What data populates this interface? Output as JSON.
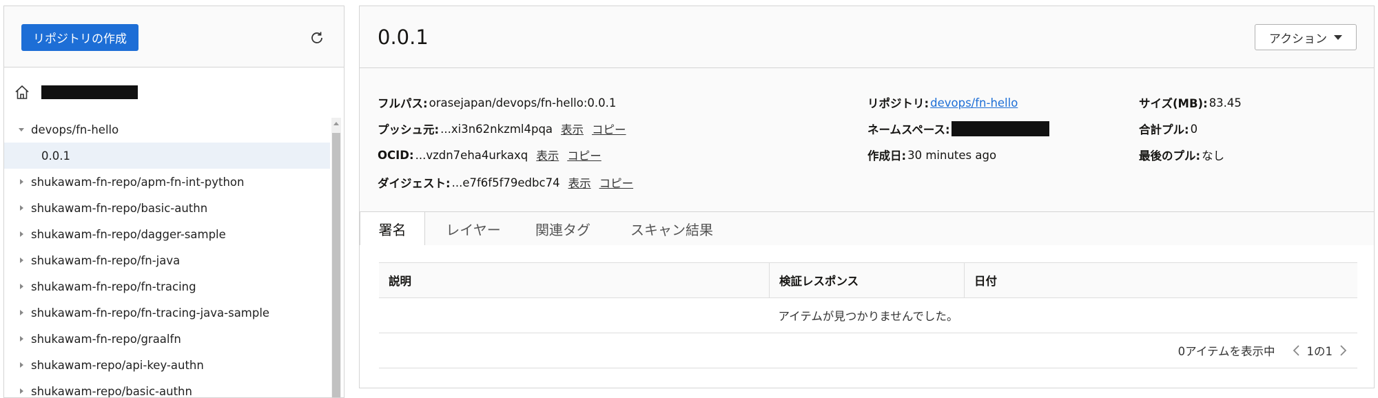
{
  "left": {
    "create_button": "リポジトリの作成",
    "refresh_icon": "refresh-icon",
    "home_icon": "home-icon",
    "tree": [
      {
        "label": "devops/fn-hello",
        "expanded": true,
        "children": [
          {
            "label": "0.0.1",
            "selected": true
          }
        ]
      },
      {
        "label": "shukawam-fn-repo/apm-fn-int-python"
      },
      {
        "label": "shukawam-fn-repo/basic-authn"
      },
      {
        "label": "shukawam-fn-repo/dagger-sample"
      },
      {
        "label": "shukawam-fn-repo/fn-java"
      },
      {
        "label": "shukawam-fn-repo/fn-tracing"
      },
      {
        "label": "shukawam-fn-repo/fn-tracing-java-sample"
      },
      {
        "label": "shukawam-fn-repo/graalfn"
      },
      {
        "label": "shukawam-repo/api-key-authn"
      },
      {
        "label": "shukawam-repo/basic-authn"
      }
    ]
  },
  "main": {
    "title": "0.0.1",
    "actions_button": "アクション",
    "details": {
      "full_path": {
        "label": "フルパス:",
        "value": "orasejapan/devops/fn-hello:0.0.1"
      },
      "push_source": {
        "label": "プッシュ元:",
        "value": "...xi3n62nkzml4pqa",
        "show": "表示",
        "copy": "コピー"
      },
      "ocid": {
        "label": "OCID:",
        "value": "...vzdn7eha4urkaxq",
        "show": "表示",
        "copy": "コピー"
      },
      "digest": {
        "label": "ダイジェスト:",
        "value": "...e7f6f5f79edbc74",
        "show": "表示",
        "copy": "コピー"
      },
      "repository": {
        "label": "リポジトリ:",
        "value": "devops/fn-hello"
      },
      "namespace": {
        "label": "ネームスペース:"
      },
      "created": {
        "label": "作成日:",
        "value": "30 minutes ago"
      },
      "size": {
        "label": "サイズ(MB):",
        "value": "83.45"
      },
      "total_pulls": {
        "label": "合計プル:",
        "value": "0"
      },
      "last_pull": {
        "label": "最後のプル:",
        "value": "なし"
      }
    },
    "tabs": [
      {
        "label": "署名",
        "active": true
      },
      {
        "label": "レイヤー"
      },
      {
        "label": "関連タグ"
      },
      {
        "label": "スキャン結果"
      }
    ],
    "table": {
      "columns": [
        "説明",
        "検証レスポンス",
        "日付"
      ],
      "empty_message": "アイテムが見つかりませんでした。",
      "items_shown": "0アイテムを表示中",
      "page_info": "1の1"
    }
  },
  "colors": {
    "primary": "#1d6ed6",
    "link": "#1d6ed6",
    "selected_row": "#ebf1f8",
    "redaction": "#111111"
  }
}
